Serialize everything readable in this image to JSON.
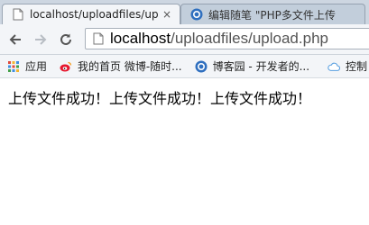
{
  "tabs": [
    {
      "title": "localhost/uploadfiles/up",
      "close": "×",
      "active": true
    },
    {
      "title": "编辑随笔 \"PHP多文件上传",
      "close": "",
      "active": false
    }
  ],
  "toolbar": {
    "back": "back",
    "forward": "forward",
    "reload": "reload"
  },
  "address_bar": {
    "host": "localhost",
    "path": "/uploadfiles/upload.php"
  },
  "bookmarks": [
    {
      "label": "应用",
      "icon": "apps-grid-icon"
    },
    {
      "label": "我的首页 微博-随时...",
      "icon": "weibo-icon"
    },
    {
      "label": "博客园 - 开发者的...",
      "icon": "cnblogs-icon"
    },
    {
      "label": "控制",
      "icon": "cloud-icon"
    }
  ],
  "page": {
    "message": "上传文件成功！上传文件成功！上传文件成功！"
  },
  "colors": {
    "tabstrip": "#cdd6e1",
    "toolbar": "#f3f5f8"
  }
}
